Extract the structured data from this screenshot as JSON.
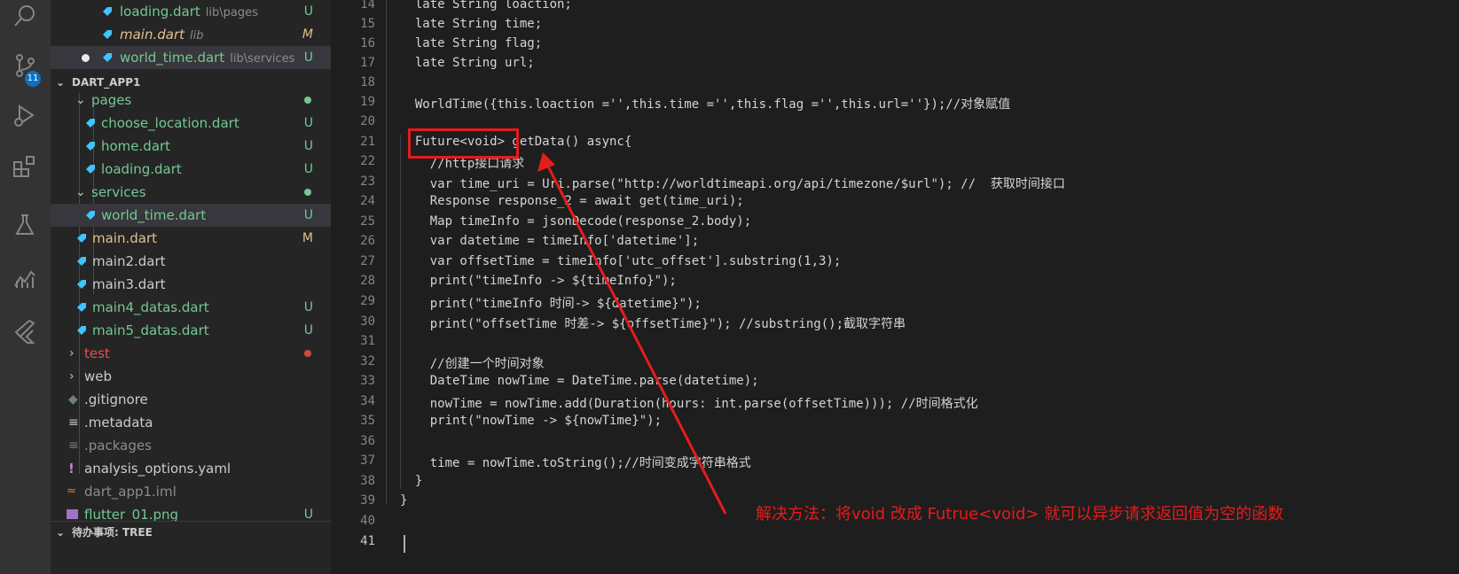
{
  "activity_bar": {
    "icons": [
      "search-icon",
      "source-control-icon",
      "run-debug-icon",
      "extensions-icon",
      "testing-icon",
      "charts-icon",
      "flutter-icon"
    ],
    "source_control_badge": "11"
  },
  "open_editors": [
    {
      "name": "loading.dart",
      "desc": "lib\\pages",
      "status": "U"
    },
    {
      "name": "main.dart",
      "desc": "lib",
      "status": "M"
    },
    {
      "name": "world_time.dart",
      "desc": "lib\\services",
      "status": "U"
    }
  ],
  "workspace_title": "DART_APP1",
  "tree": [
    {
      "name": "pages",
      "type": "folder",
      "status": "dot"
    },
    {
      "name": "choose_location.dart",
      "type": "dart",
      "status": "U"
    },
    {
      "name": "home.dart",
      "type": "dart",
      "status": "U"
    },
    {
      "name": "loading.dart",
      "type": "dart",
      "status": "U"
    },
    {
      "name": "services",
      "type": "folder",
      "status": "dot"
    },
    {
      "name": "world_time.dart",
      "type": "dart",
      "status": "U"
    },
    {
      "name": "main.dart",
      "type": "dart",
      "status": "M"
    },
    {
      "name": "main2.dart",
      "type": "dart",
      "status": ""
    },
    {
      "name": "main3.dart",
      "type": "dart",
      "status": ""
    },
    {
      "name": "main4_datas.dart",
      "type": "dart",
      "status": "U"
    },
    {
      "name": "main5_datas.dart",
      "type": "dart",
      "status": "U"
    },
    {
      "name": "test",
      "type": "folder",
      "status": "dot"
    },
    {
      "name": "web",
      "type": "folder",
      "status": ""
    },
    {
      "name": ".gitignore",
      "type": "file",
      "status": ""
    },
    {
      "name": ".metadata",
      "type": "file",
      "status": ""
    },
    {
      "name": ".packages",
      "type": "file",
      "status": ""
    },
    {
      "name": "analysis_options.yaml",
      "type": "file",
      "status": ""
    },
    {
      "name": "dart_app1.iml",
      "type": "file",
      "status": ""
    },
    {
      "name": "flutter_01.png",
      "type": "file",
      "status": "U"
    }
  ],
  "todo_section": "待办事项: TREE",
  "line_numbers": [
    "14",
    "15",
    "16",
    "17",
    "18",
    "19",
    "20",
    "21",
    "22",
    "23",
    "24",
    "25",
    "26",
    "27",
    "28",
    "29",
    "30",
    "31",
    "32",
    "33",
    "34",
    "35",
    "36",
    "37",
    "38",
    "39",
    "40",
    "41"
  ],
  "code_lines": [
    "  late String loaction;",
    "  late String time;",
    "  late String flag;",
    "  late String url;",
    "",
    "  WorldTime({this.loaction ='',this.time ='',this.flag ='',this.url=''});//对象赋值",
    "",
    "  Future<void> getData() async{",
    "    //http接口请求",
    "    var time_uri = Uri.parse(\"http://worldtimeapi.org/api/timezone/$url\"); //  获取时间接口",
    "    Response response_2 = await get(time_uri);",
    "    Map timeInfo = jsonDecode(response_2.body);",
    "    var datetime = timeInfo['datetime'];",
    "    var offsetTime = timeInfo['utc_offset'].substring(1,3);",
    "    print(\"timeInfo -> ${timeInfo}\");",
    "    print(\"timeInfo 时间-> ${datetime}\");",
    "    print(\"offsetTime 时差-> ${offsetTime}\"); //substring();截取字符串",
    "",
    "    //创建一个时间对象",
    "    DateTime nowTime = DateTime.parse(datetime);",
    "    nowTime = nowTime.add(Duration(hours: int.parse(offsetTime))); //时间格式化",
    "    print(\"nowTime -> ${nowTime}\");",
    "",
    "    time = nowTime.toString();//时间变成字符串格式",
    "  }",
    "}",
    "",
    ""
  ],
  "annotation": "解决方法：将void 改成 Futrue<void> 就可以异步请求返回值为空的函数",
  "colors": {
    "annotation_red": "#e51c1c",
    "untracked_green": "#73c991",
    "modified_yellow": "#e2c08d",
    "deleted_red": "#f14c4c"
  }
}
